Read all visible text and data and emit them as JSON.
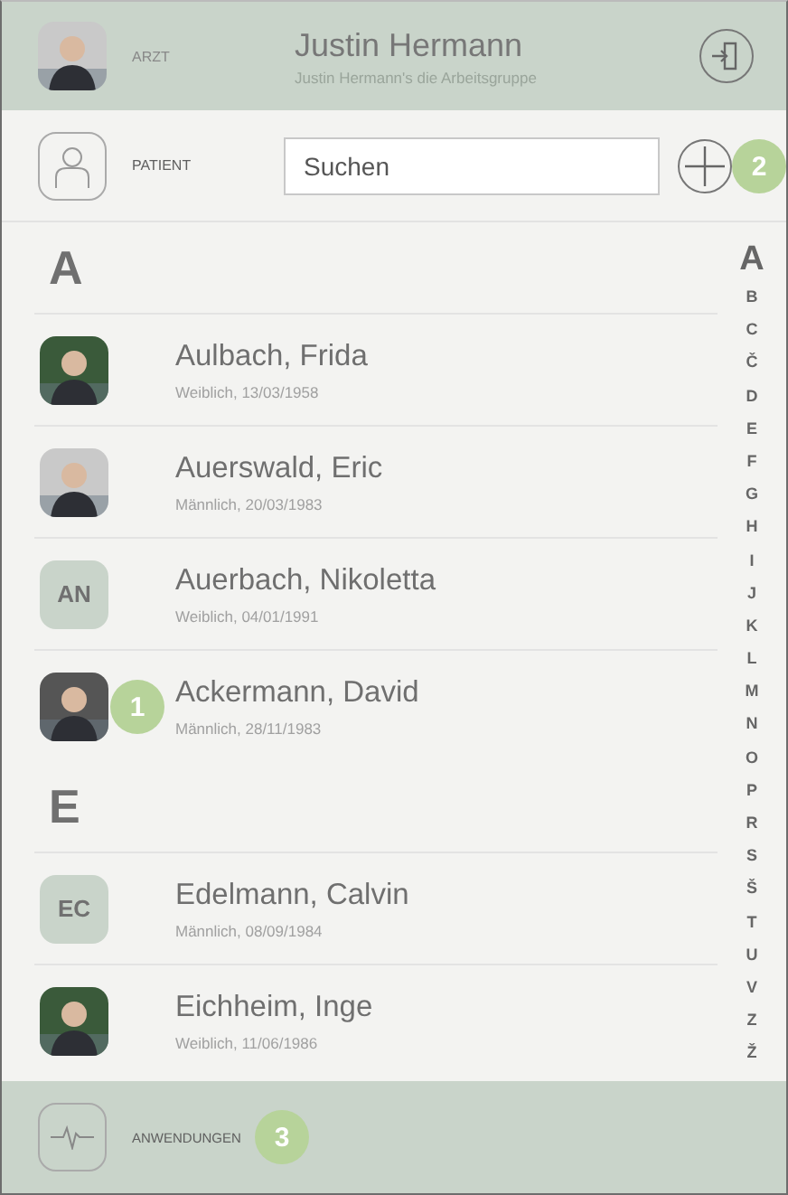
{
  "header": {
    "role": "ARZT",
    "name": "Justin Hermann",
    "group": "Justin Hermann's die Arbeitsgruppe"
  },
  "patient_bar": {
    "label": "PATIENT",
    "search": {
      "placeholder": "Suchen"
    },
    "add_marker": "2"
  },
  "sections": [
    {
      "letter": "A",
      "patients": [
        {
          "name": "Aulbach, Frida",
          "details": "Weiblich, 13/03/1958"
        },
        {
          "name": "Auerswald, Eric",
          "details": "Männlich, 20/03/1983"
        },
        {
          "name": "Auerbach, Nikoletta",
          "details": "Weiblich, 04/01/1991",
          "avatar": {
            "kind": "initials",
            "text": "AN"
          }
        },
        {
          "name": "Ackermann, David",
          "details": "Männlich, 28/11/1983",
          "marker": "1"
        }
      ]
    },
    {
      "letter": "E",
      "patients": [
        {
          "name": "Edelmann, Calvin",
          "details": "Männlich, 08/09/1984",
          "avatar": {
            "kind": "initials",
            "text": "EC"
          }
        },
        {
          "name": "Eichheim, Inge",
          "details": "Weiblich, 11/06/1986"
        }
      ]
    }
  ],
  "index": [
    {
      "letter": "A",
      "selected": true
    },
    {
      "letter": "B",
      "selected": false
    },
    {
      "letter": "C",
      "selected": false
    },
    {
      "letter": "Č",
      "selected": false
    },
    {
      "letter": "D",
      "selected": false
    },
    {
      "letter": "E",
      "selected": false
    },
    {
      "letter": "F",
      "selected": false
    },
    {
      "letter": "G",
      "selected": false
    },
    {
      "letter": "H",
      "selected": false
    },
    {
      "letter": "I",
      "selected": false
    },
    {
      "letter": "J",
      "selected": false
    },
    {
      "letter": "K",
      "selected": false
    },
    {
      "letter": "L",
      "selected": false
    },
    {
      "letter": "M",
      "selected": false
    },
    {
      "letter": "N",
      "selected": false
    },
    {
      "letter": "O",
      "selected": false
    },
    {
      "letter": "P",
      "selected": false
    },
    {
      "letter": "R",
      "selected": false
    },
    {
      "letter": "S",
      "selected": false
    },
    {
      "letter": "Š",
      "selected": false
    },
    {
      "letter": "T",
      "selected": false
    },
    {
      "letter": "U",
      "selected": false
    },
    {
      "letter": "V",
      "selected": false
    },
    {
      "letter": "Z",
      "selected": false
    },
    {
      "letter": "Ž",
      "selected": false
    }
  ],
  "footer": {
    "label": "ANWENDUNGEN",
    "marker": "3"
  }
}
